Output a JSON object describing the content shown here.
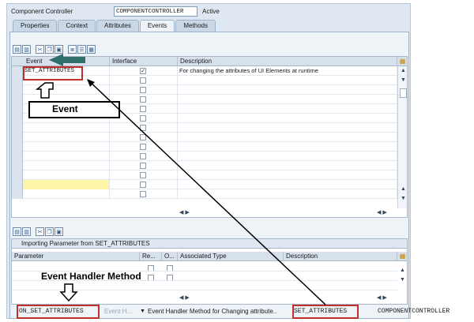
{
  "header": {
    "label": "Component Controller",
    "field_value": "COMPONENTCONTROLLER",
    "status": "Active"
  },
  "tabs": [
    {
      "label": "Properties",
      "active": false
    },
    {
      "label": "Context",
      "active": false
    },
    {
      "label": "Attributes",
      "active": false
    },
    {
      "label": "Events",
      "active": true
    },
    {
      "label": "Methods",
      "active": false
    }
  ],
  "events_table": {
    "columns": [
      "Event",
      "Interface",
      "Description"
    ],
    "rows": [
      {
        "event": "SET_ATTRIBUTES",
        "interface": true,
        "description": "For changing the attributes of UI Elements at runtime"
      }
    ]
  },
  "params_table": {
    "title": "Importing Parameter from SET_ATTRIBUTES",
    "columns": [
      "Parameter",
      "Re...",
      "O...",
      "Associated Type",
      "Description"
    ]
  },
  "annotations": {
    "event_note": "Event",
    "handler_note": "Event Handler Method"
  },
  "status_bar": {
    "handler_name": "ON_SET_ATTRIBUTES",
    "handler_type": "Event H...",
    "handler_desc": "Event Handler Method for Changing attribute..",
    "event_name": "SET_ATTRIBUTES",
    "controller": "COMPONENTCONTROLLER"
  },
  "colors": {
    "annotation_red": "#c0302a",
    "arrow_teal": "#2f6f6a"
  }
}
